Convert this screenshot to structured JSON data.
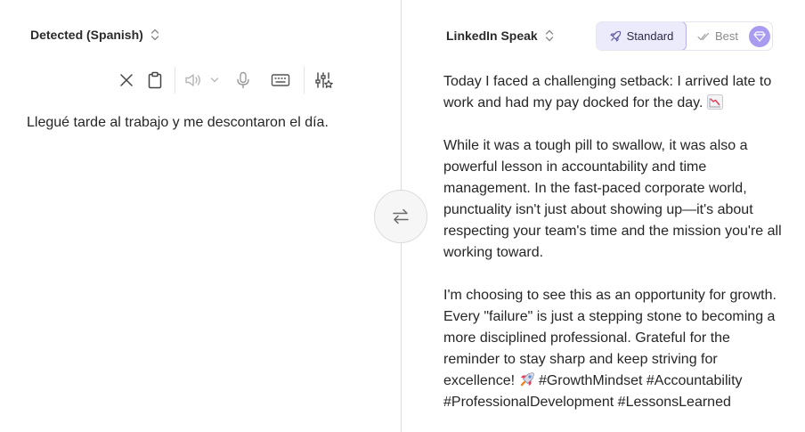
{
  "source": {
    "language_label": "Detected (Spanish)",
    "text": "Llegué tarde al trabajo y me descontaron el día."
  },
  "target": {
    "language_label": "LinkedIn Speak",
    "mode_standard_label": "Standard",
    "mode_best_label": "Best",
    "paragraphs": [
      "Today I faced a challenging setback: I arrived late to work and had my pay docked for the day.",
      "While it was a tough pill to swallow, it was also a powerful lesson in accountability and time management. In the fast-paced corporate world, punctuality isn't just about showing up—it's about respecting your team's time and the mission you're all working toward.",
      "I'm choosing to see this as an opportunity for growth. Every \"failure\" is just a stepping stone to becoming a more disciplined professional. Grateful for the reminder to stay sharp and keep striving for excellence!"
    ],
    "hashtags": "#GrowthMindset #Accountability #ProfessionalDevelopment #LessonsLearned"
  },
  "icons": {
    "clear": "close-icon",
    "clipboard": "clipboard-icon",
    "speaker": "speaker-icon",
    "mic": "microphone-icon",
    "keyboard": "keyboard-icon",
    "settings": "sliders-icon",
    "swap": "swap-arrows-icon",
    "chart_emoji": "chart-decreasing-emoji",
    "rocket_emoji": "rocket-emoji"
  },
  "colors": {
    "accent": "#a99cf0",
    "standard_bg": "#ecebfb",
    "divider": "#dcdcdc"
  }
}
